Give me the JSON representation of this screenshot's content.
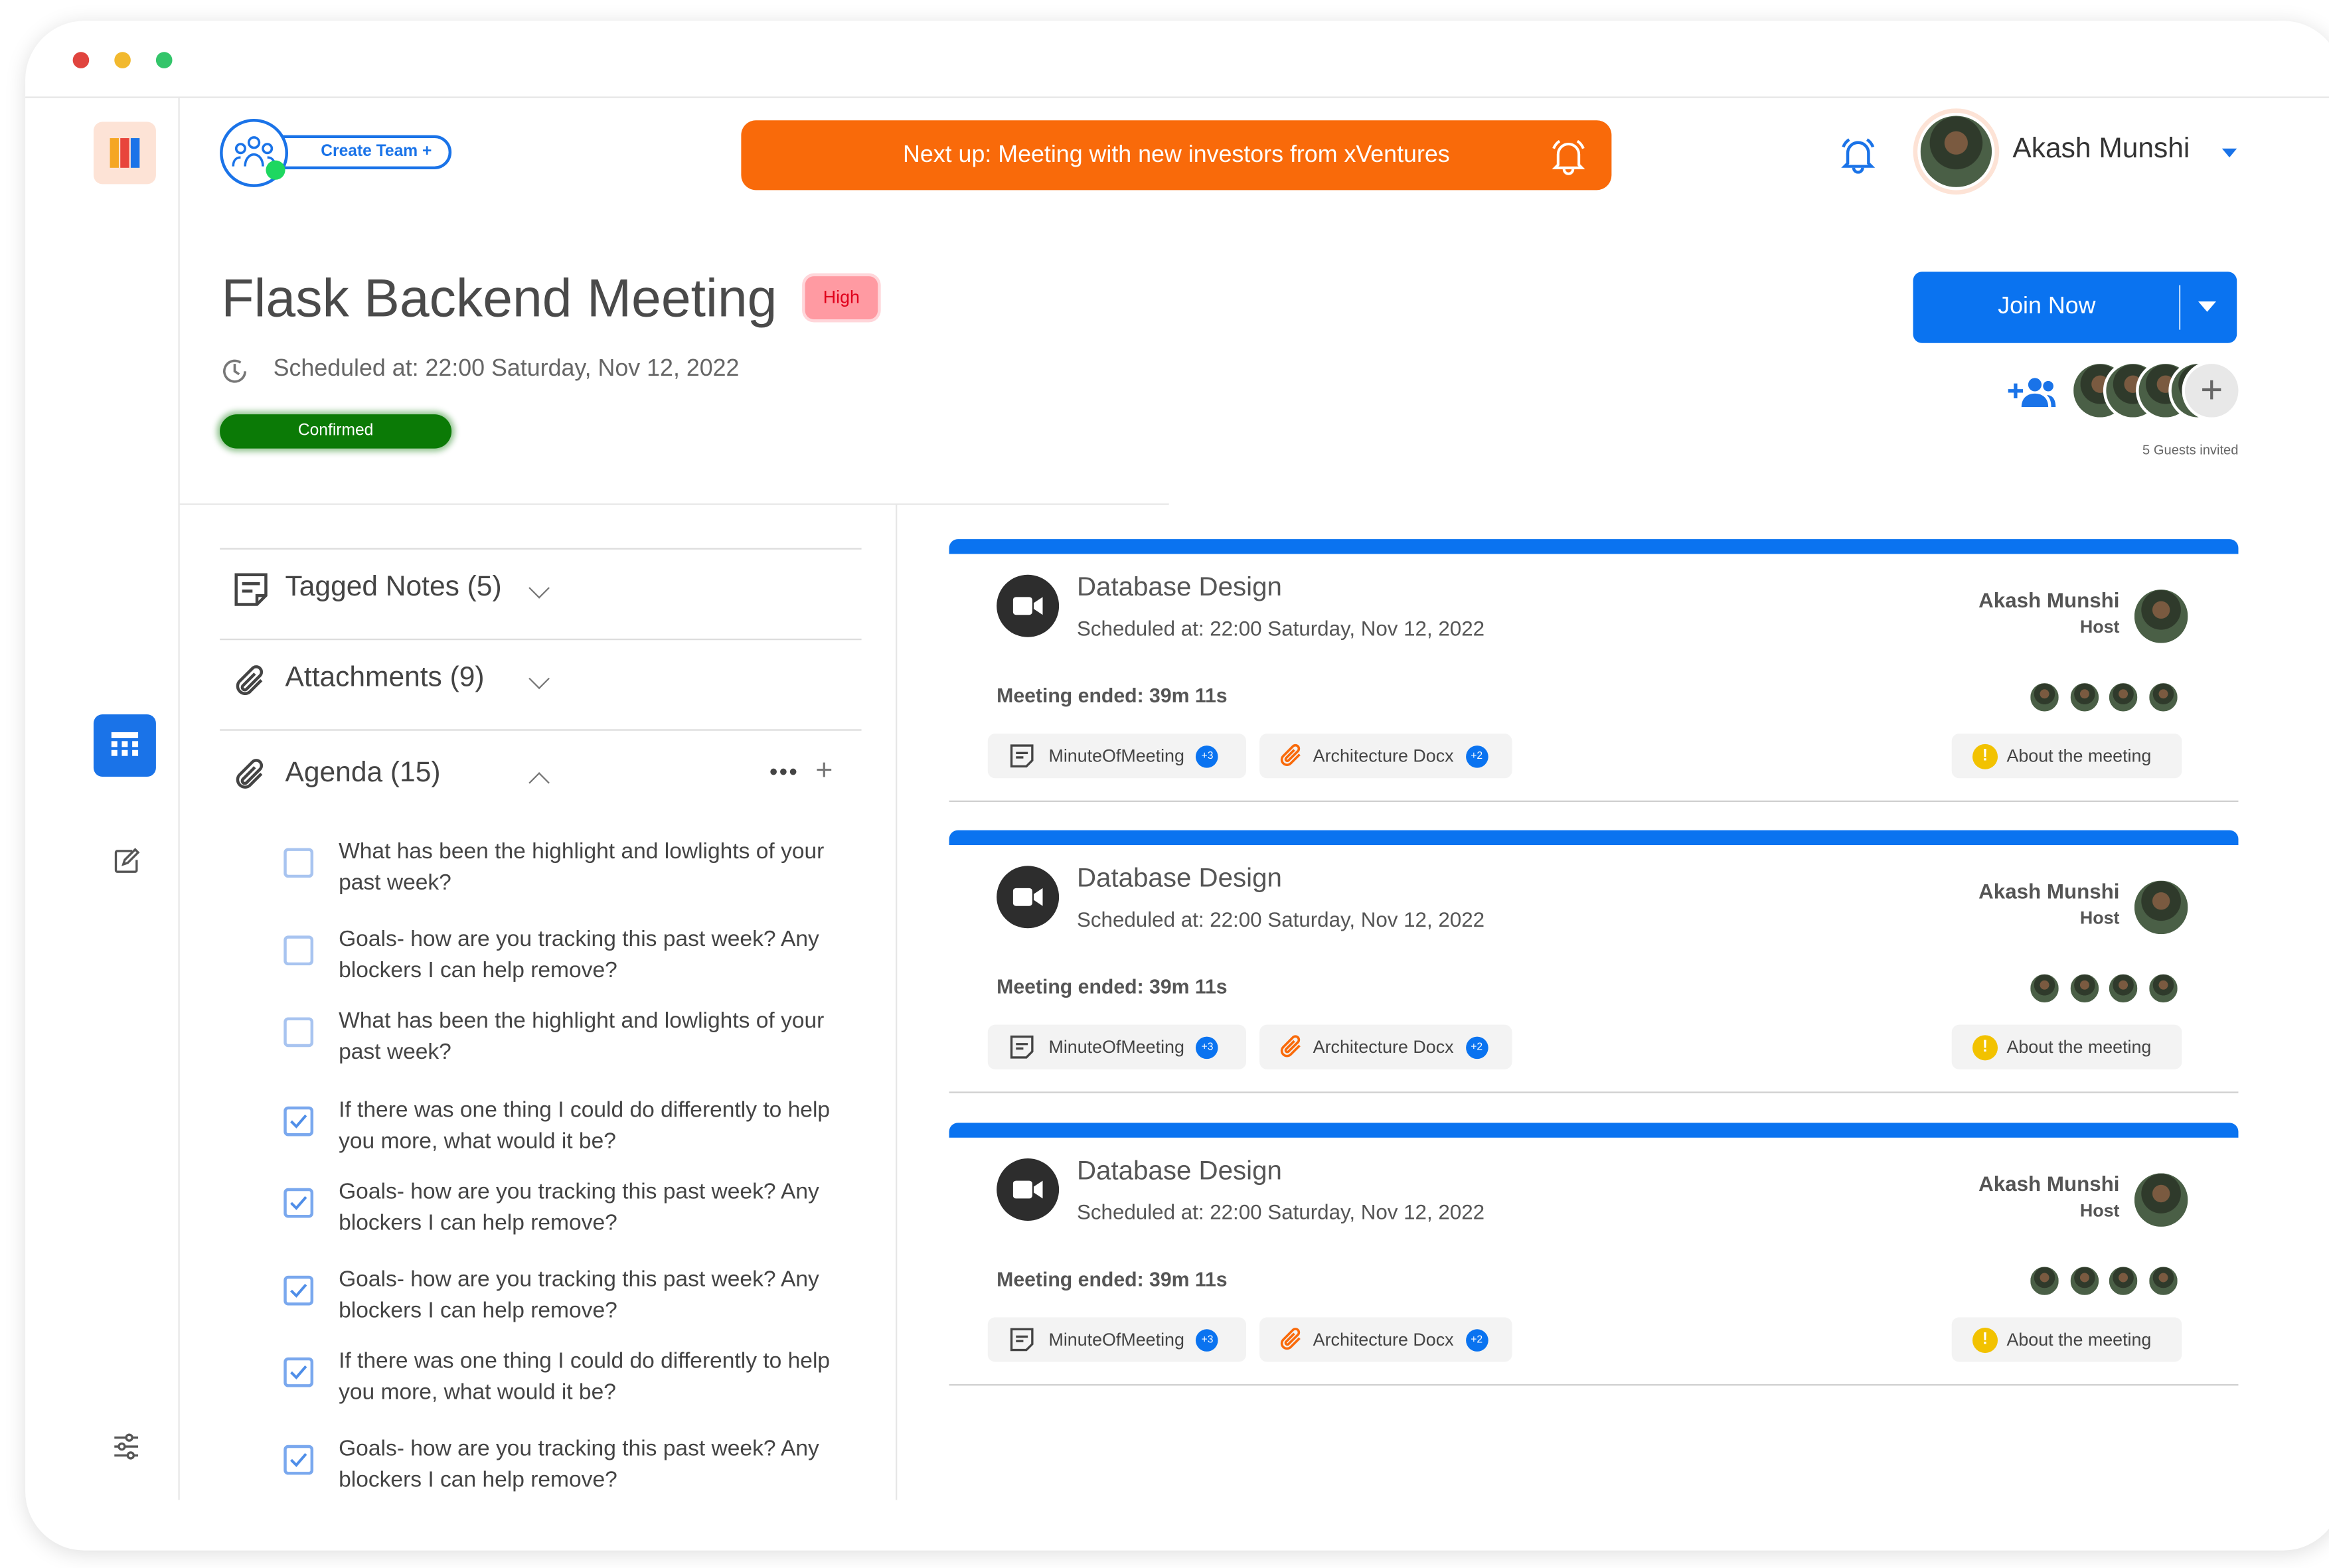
{
  "colors": {
    "primary": "#0a73f0",
    "banner": "#f96a0a",
    "confirmed": "#0b7a06",
    "high": "#ff9aa2"
  },
  "header": {
    "create_team_label": "Create Team +",
    "banner_text": "Next up: Meeting with new investors from xVentures",
    "user_name": "Akash Munshi"
  },
  "meeting": {
    "title": "Flask Backend Meeting",
    "priority": "High",
    "scheduled": "Scheduled at: 22:00 Saturday, Nov 12, 2022",
    "status": "Confirmed",
    "join_label": "Join Now",
    "guests_text": "5 Guests invited"
  },
  "sections": {
    "tagged_notes": "Tagged Notes (5)",
    "attachments": "Attachments (9)",
    "agenda": "Agenda (15)"
  },
  "agenda_items": [
    {
      "text": "What has been the highlight and lowlights of your past week?",
      "checked": false
    },
    {
      "text": "Goals- how are you tracking this past week? Any blockers I can help remove?",
      "checked": false
    },
    {
      "text": "What has been the highlight and lowlights of your past week?",
      "checked": false
    },
    {
      "text": "If there was one thing I could do differently to help you more, what would it be?",
      "checked": true
    },
    {
      "text": "Goals- how are you tracking this past week? Any blockers I can help remove?",
      "checked": true
    },
    {
      "text": "Goals- how are you tracking this past week? Any blockers I can help remove?",
      "checked": true
    },
    {
      "text": "If there was one thing I could do differently to help you more, what would it be?",
      "checked": true
    },
    {
      "text": "Goals- how are you tracking this past week? Any blockers I can help remove?",
      "checked": true
    }
  ],
  "meetings": [
    {
      "title": "Database Design",
      "scheduled": "Scheduled at: 22:00 Saturday, Nov 12, 2022",
      "ended": "Meeting ended: 39m 11s",
      "host": "Akash Munshi",
      "host_role": "Host",
      "chip1": "MinuteOfMeeting",
      "chip1_count": "+3",
      "chip2": "Architecture Docx",
      "chip2_count": "+2",
      "about": "About the meeting"
    },
    {
      "title": "Database Design",
      "scheduled": "Scheduled at: 22:00 Saturday, Nov 12, 2022",
      "ended": "Meeting ended: 39m 11s",
      "host": "Akash Munshi",
      "host_role": "Host",
      "chip1": "MinuteOfMeeting",
      "chip1_count": "+3",
      "chip2": "Architecture Docx",
      "chip2_count": "+2",
      "about": "About the meeting"
    },
    {
      "title": "Database Design",
      "scheduled": "Scheduled at: 22:00 Saturday, Nov 12, 2022",
      "ended": "Meeting ended: 39m 11s",
      "host": "Akash Munshi",
      "host_role": "Host",
      "chip1": "MinuteOfMeeting",
      "chip1_count": "+3",
      "chip2": "Architecture Docx",
      "chip2_count": "+2",
      "about": "About the meeting"
    }
  ]
}
